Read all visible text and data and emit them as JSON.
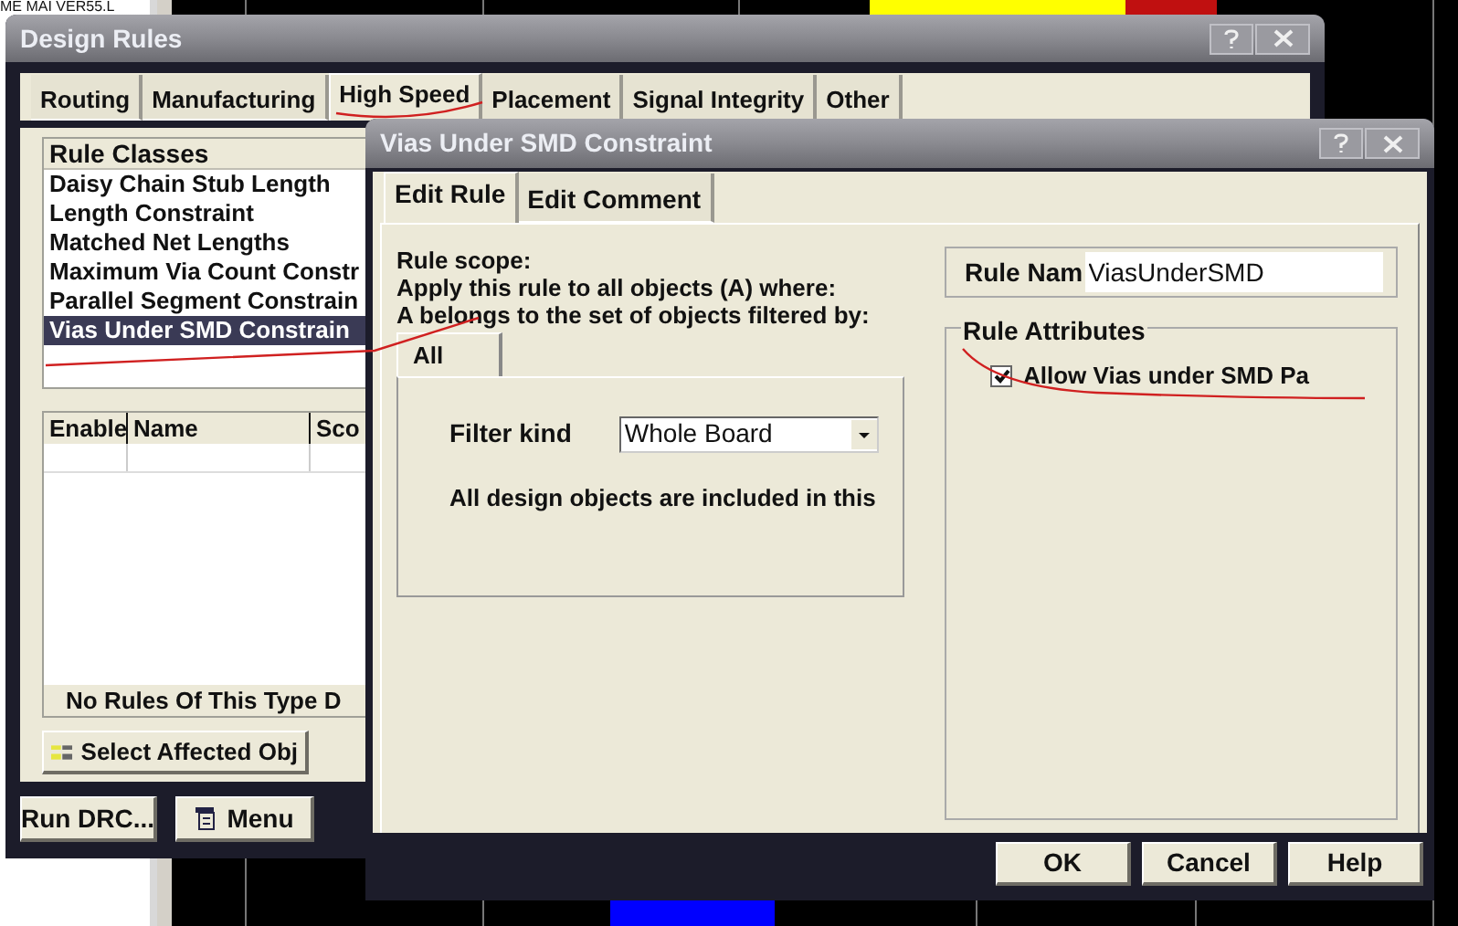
{
  "background": {
    "text": "ME MAI VER55.L"
  },
  "design_rules": {
    "title": "Design Rules",
    "tabs": [
      {
        "label": "Routing",
        "selected": false
      },
      {
        "label": "Manufacturing",
        "selected": false
      },
      {
        "label": "High Speed",
        "selected": true
      },
      {
        "label": "Placement",
        "selected": false
      },
      {
        "label": "Signal Integrity",
        "selected": false
      },
      {
        "label": "Other",
        "selected": false
      }
    ],
    "rule_classes": {
      "header": "Rule Classes",
      "items": [
        {
          "label": "Daisy Chain Stub Length",
          "selected": false
        },
        {
          "label": "Length Constraint",
          "selected": false
        },
        {
          "label": "Matched Net Lengths",
          "selected": false
        },
        {
          "label": "Maximum Via Count Constr",
          "selected": false
        },
        {
          "label": "Parallel Segment Constrain",
          "selected": false
        },
        {
          "label": "Vias Under SMD Constrain",
          "selected": true
        }
      ]
    },
    "table": {
      "columns": [
        "Enable",
        "Name",
        "Sco"
      ],
      "footer": "No Rules Of This Type D"
    },
    "select_button": "Select Affected Obj",
    "buttons": [
      "Run DRC...",
      "Menu"
    ]
  },
  "constraint_dialog": {
    "title": "Vias Under SMD Constraint",
    "tabs": [
      {
        "label": "Edit Rule",
        "selected": true
      },
      {
        "label": "Edit Comment",
        "selected": false
      }
    ],
    "scope_lines": [
      "Rule scope:",
      "Apply this rule to all objects (A) where:",
      "A belongs to the set of objects filtered by:"
    ],
    "filter_tab": "All",
    "filter_kind": {
      "label": "Filter kind",
      "value": "Whole Board"
    },
    "filter_note": "All design objects are included in this",
    "rule_name": {
      "label": "Rule Nam",
      "value": "ViasUnderSMD"
    },
    "attributes": {
      "title": "Rule Attributes",
      "options": [
        {
          "label": "Allow Vias under SMD Pa",
          "checked": true
        }
      ]
    },
    "buttons": [
      "OK",
      "Cancel",
      "Help"
    ]
  }
}
